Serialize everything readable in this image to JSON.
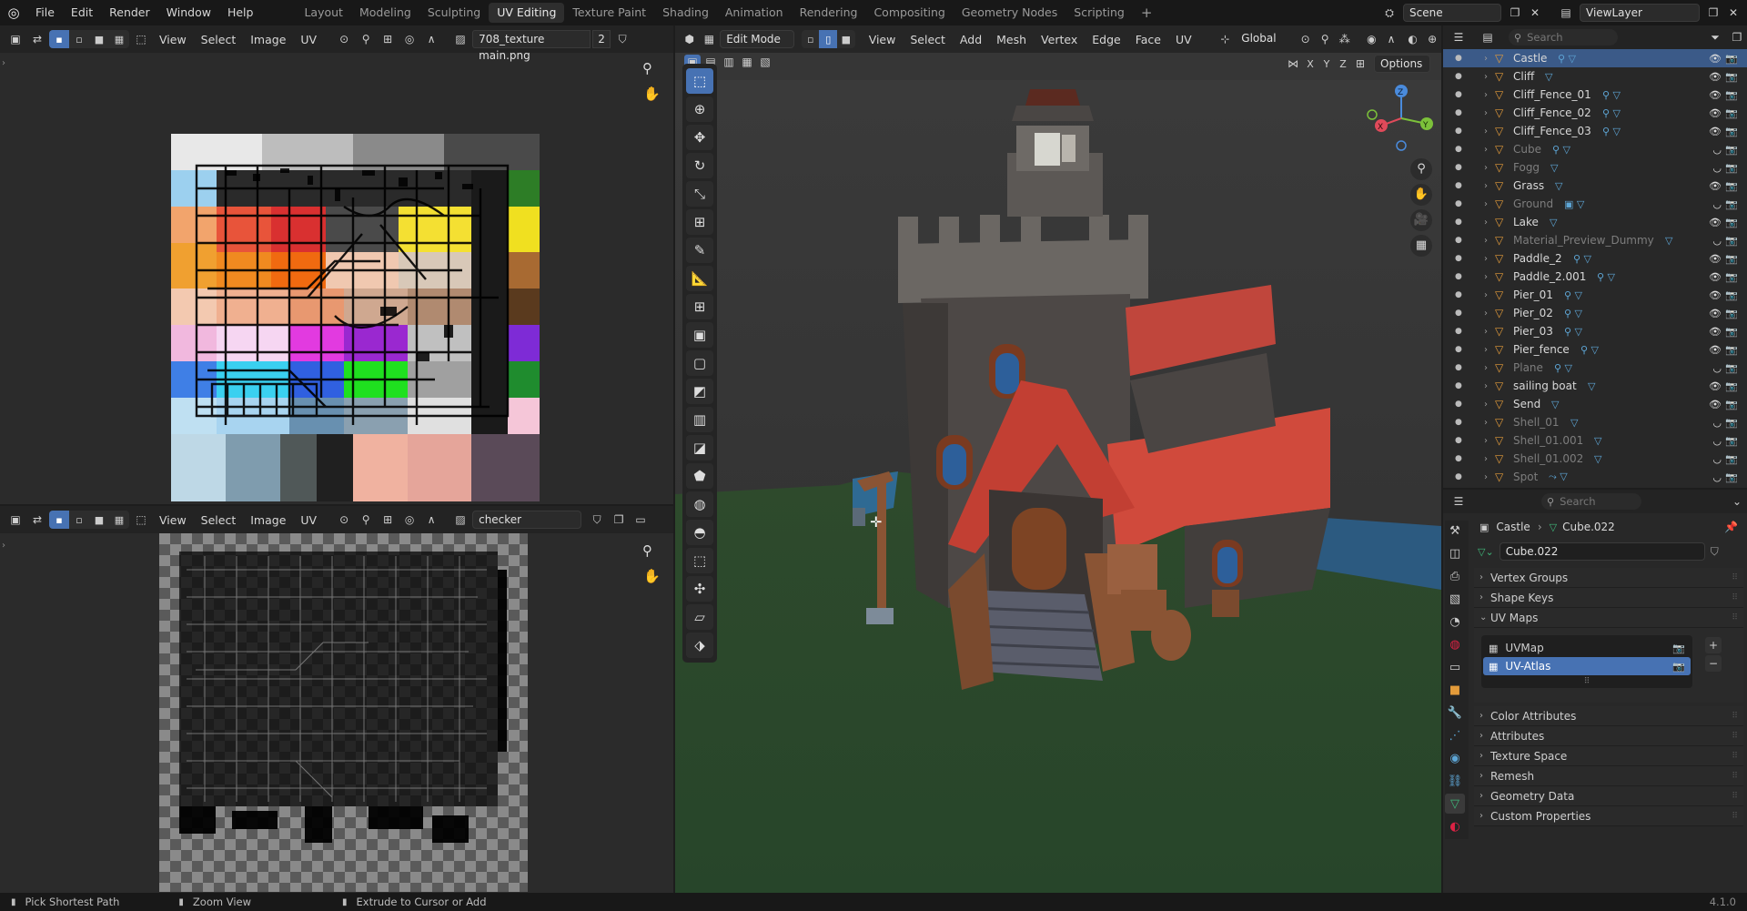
{
  "topbar": {
    "menus": [
      "File",
      "Edit",
      "Render",
      "Window",
      "Help"
    ],
    "workspaces": [
      "Layout",
      "Modeling",
      "Sculpting",
      "UV Editing",
      "Texture Paint",
      "Shading",
      "Animation",
      "Rendering",
      "Compositing",
      "Geometry Nodes",
      "Scripting"
    ],
    "active_workspace": "UV Editing",
    "plus": "+",
    "scene": "Scene",
    "view_layer": "ViewLayer"
  },
  "uv_top": {
    "menus": [
      "View",
      "Select",
      "Image",
      "UV"
    ],
    "image_name": "708_texture main.png",
    "users": "2"
  },
  "uv_bottom": {
    "menus": [
      "View",
      "Select",
      "Image",
      "UV"
    ],
    "image_name": "checker"
  },
  "viewport": {
    "mode": "Edit Mode",
    "menus": [
      "View",
      "Select",
      "Add",
      "Mesh",
      "Vertex",
      "Edge",
      "Face",
      "UV"
    ],
    "orientation": "Global",
    "options": "Options",
    "axes": [
      "X",
      "Y",
      "Z"
    ],
    "gizmo_labels": {
      "x": "X",
      "y": "Y",
      "z": "Z"
    }
  },
  "outliner": {
    "search_placeholder": "Search",
    "items": [
      {
        "name": "Castle",
        "dim": false,
        "sel": true,
        "icons": "⚲ ▽"
      },
      {
        "name": "Cliff",
        "dim": false,
        "sel": false,
        "icons": "▽"
      },
      {
        "name": "Cliff_Fence_01",
        "dim": false,
        "sel": false,
        "icons": "⚲ ▽"
      },
      {
        "name": "Cliff_Fence_02",
        "dim": false,
        "sel": false,
        "icons": "⚲ ▽"
      },
      {
        "name": "Cliff_Fence_03",
        "dim": false,
        "sel": false,
        "icons": "⚲ ▽"
      },
      {
        "name": "Cube",
        "dim": true,
        "sel": false,
        "icons": "⚲ ▽"
      },
      {
        "name": "Fogg",
        "dim": true,
        "sel": false,
        "icons": "▽"
      },
      {
        "name": "Grass",
        "dim": false,
        "sel": false,
        "icons": "▽"
      },
      {
        "name": "Ground",
        "dim": true,
        "sel": false,
        "icons": "▣ ▽"
      },
      {
        "name": "Lake",
        "dim": false,
        "sel": false,
        "icons": "▽"
      },
      {
        "name": "Material_Preview_Dummy",
        "dim": true,
        "sel": false,
        "icons": "▽"
      },
      {
        "name": "Paddle_2",
        "dim": false,
        "sel": false,
        "icons": "⚲ ▽"
      },
      {
        "name": "Paddle_2.001",
        "dim": false,
        "sel": false,
        "icons": "⚲ ▽"
      },
      {
        "name": "Pier_01",
        "dim": false,
        "sel": false,
        "icons": "⚲ ▽"
      },
      {
        "name": "Pier_02",
        "dim": false,
        "sel": false,
        "icons": "⚲ ▽"
      },
      {
        "name": "Pier_03",
        "dim": false,
        "sel": false,
        "icons": "⚲ ▽"
      },
      {
        "name": "Pier_fence",
        "dim": false,
        "sel": false,
        "icons": "⚲ ▽"
      },
      {
        "name": "Plane",
        "dim": true,
        "sel": false,
        "icons": "⚲ ▽"
      },
      {
        "name": "sailing boat",
        "dim": false,
        "sel": false,
        "icons": "▽"
      },
      {
        "name": "Send",
        "dim": false,
        "sel": false,
        "icons": "▽"
      },
      {
        "name": "Shell_01",
        "dim": true,
        "sel": false,
        "icons": "▽"
      },
      {
        "name": "Shell_01.001",
        "dim": true,
        "sel": false,
        "icons": "▽"
      },
      {
        "name": "Shell_01.002",
        "dim": true,
        "sel": false,
        "icons": "▽"
      },
      {
        "name": "Spot",
        "dim": true,
        "sel": false,
        "icons": "⤳ ▽"
      }
    ]
  },
  "properties": {
    "search_placeholder": "Search",
    "breadcrumb_object": "Castle",
    "breadcrumb_data": "Cube.022",
    "data_name": "Cube.022",
    "panels_before": [
      "Vertex Groups",
      "Shape Keys"
    ],
    "uv_maps_label": "UV Maps",
    "uv_maps": [
      {
        "name": "UVMap",
        "active": false
      },
      {
        "name": "UV-Atlas",
        "active": true
      }
    ],
    "panels_after": [
      "Color Attributes",
      "Attributes",
      "Texture Space",
      "Remesh",
      "Geometry Data",
      "Custom Properties"
    ],
    "plus": "+",
    "minus": "−"
  },
  "status": {
    "left": "Pick Shortest Path",
    "middle": "Zoom View",
    "right": "Extrude to Cursor or Add",
    "version": "4.1.0"
  },
  "colors": {
    "accent": "#4772b3",
    "outliner_selected": "#3b5a88",
    "object_orange": "#e39b3a",
    "mesh_green": "#3fb87a",
    "modifier_blue": "#5ea6d6"
  }
}
